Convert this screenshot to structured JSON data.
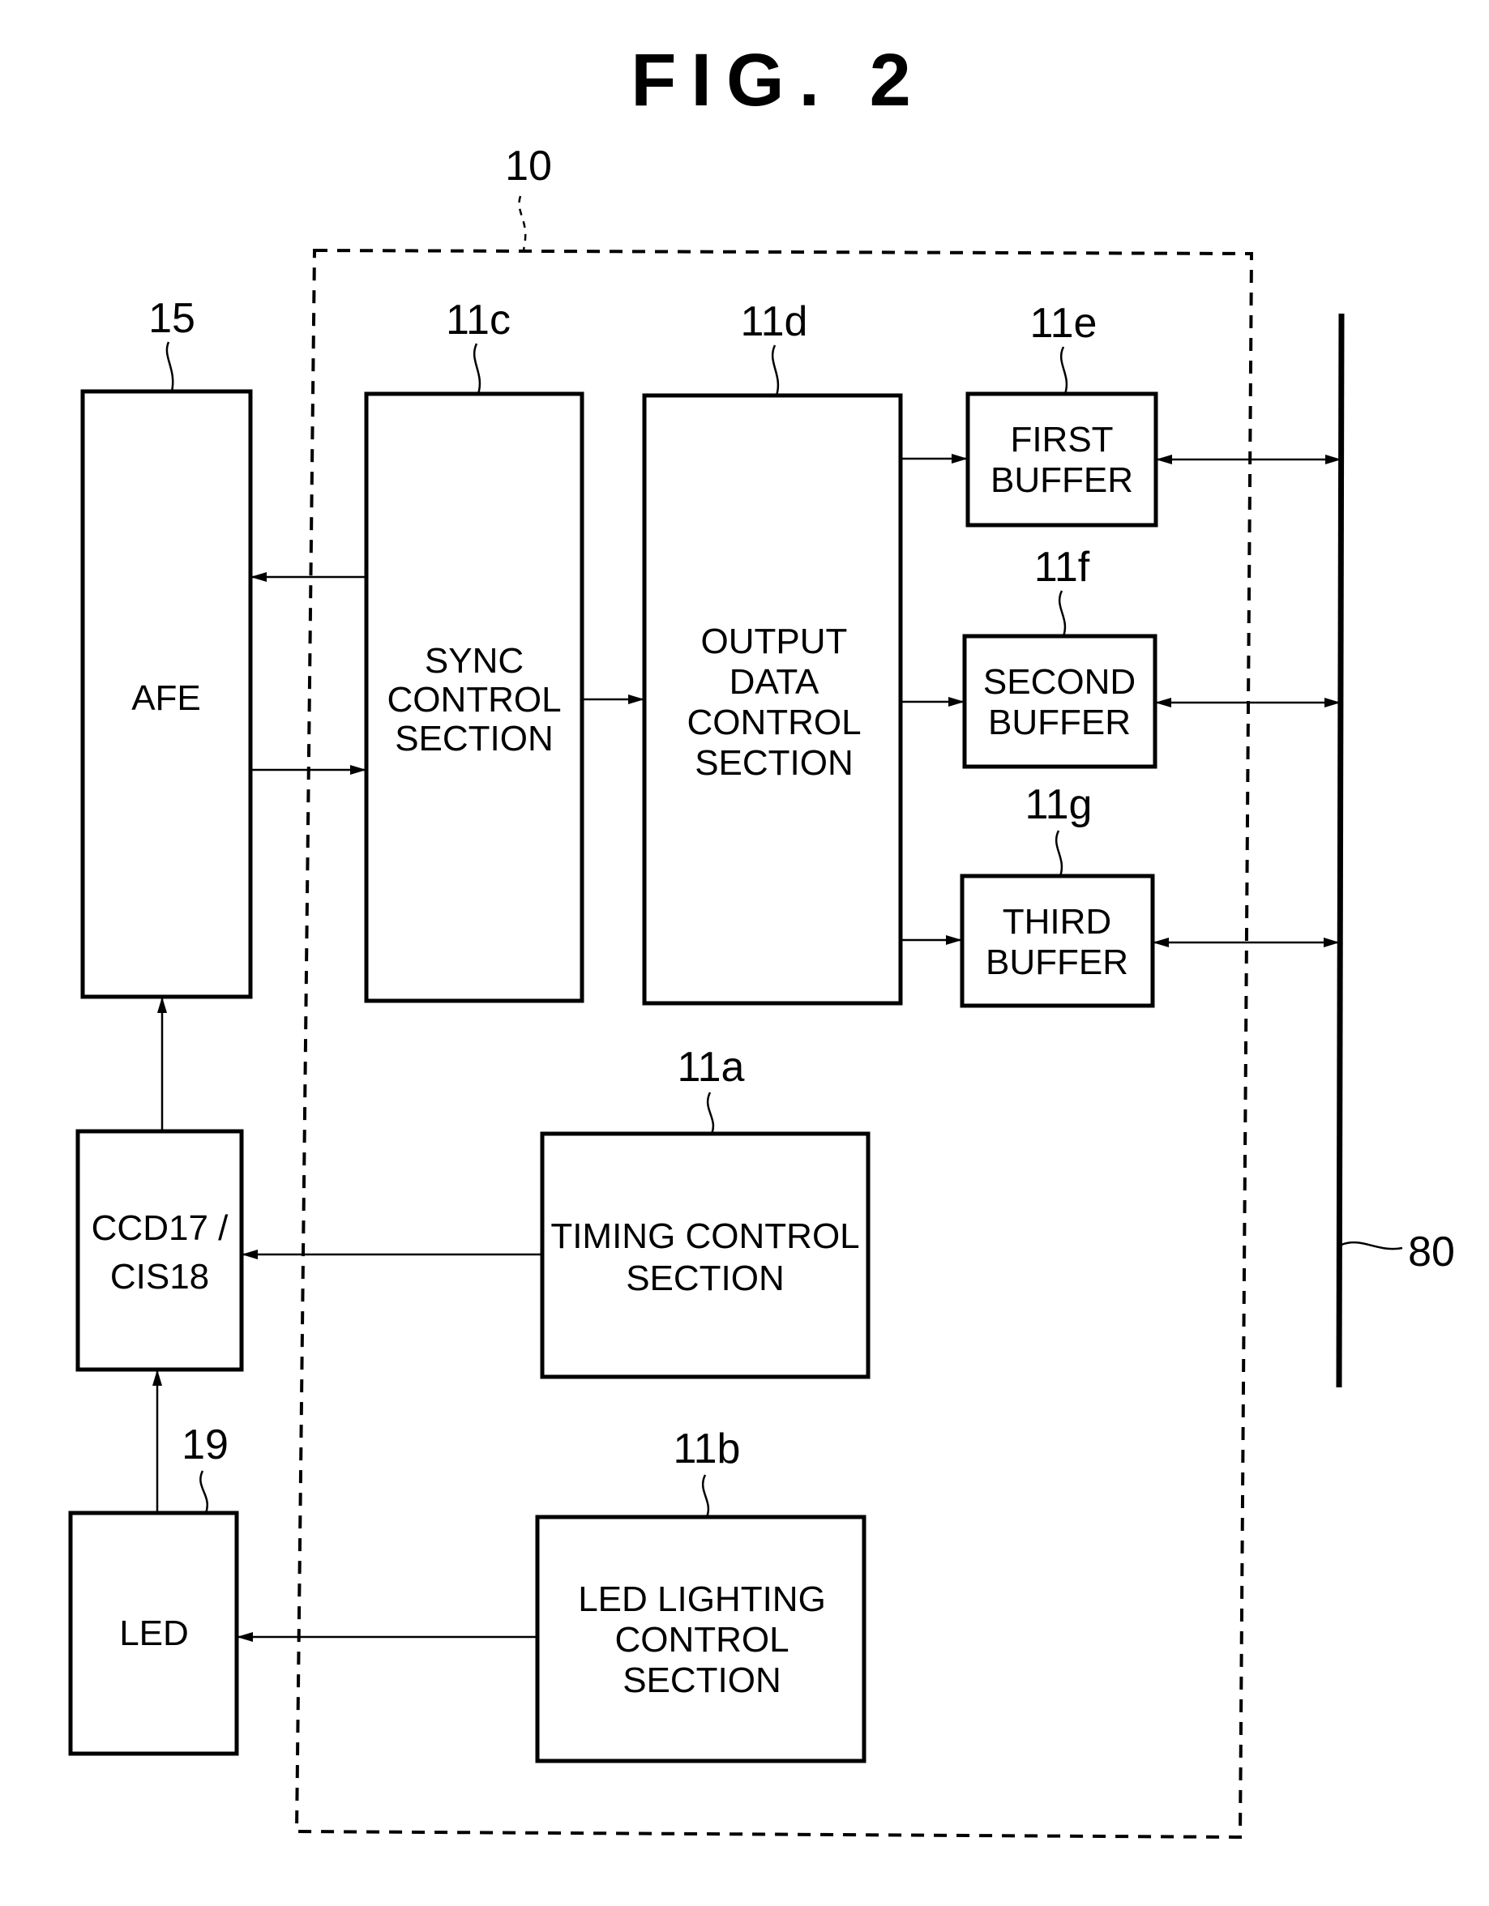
{
  "figure": {
    "title": "FIG. 2"
  },
  "container": {
    "ref": "10"
  },
  "bus": {
    "ref": "80"
  },
  "blocks": {
    "afe": {
      "ref": "15",
      "lines": [
        "AFE"
      ]
    },
    "sync": {
      "ref": "11c",
      "lines": [
        "SYNC",
        "CONTROL",
        "SECTION"
      ]
    },
    "output": {
      "ref": "11d",
      "lines": [
        "OUTPUT",
        "DATA",
        "CONTROL",
        "SECTION"
      ]
    },
    "first_buffer": {
      "ref": "11e",
      "lines": [
        "FIRST",
        "BUFFER"
      ]
    },
    "second_buffer": {
      "ref": "11f",
      "lines": [
        "SECOND",
        "BUFFER"
      ]
    },
    "third_buffer": {
      "ref": "11g",
      "lines": [
        "THIRD",
        "BUFFER"
      ]
    },
    "ccd": {
      "ref": "",
      "lines": [
        "CCD17 /",
        "CIS18"
      ]
    },
    "timing": {
      "ref": "11a",
      "lines": [
        "TIMING CONTROL",
        "SECTION"
      ]
    },
    "led": {
      "ref": "19",
      "lines": [
        "LED"
      ]
    },
    "led_lighting": {
      "ref": "11b",
      "lines": [
        "LED LIGHTING",
        "CONTROL",
        "SECTION"
      ]
    }
  },
  "connections": [
    {
      "from": "sync",
      "to": "afe",
      "direction": "one-way"
    },
    {
      "from": "afe",
      "to": "sync",
      "direction": "one-way"
    },
    {
      "from": "sync",
      "to": "output",
      "direction": "one-way"
    },
    {
      "from": "output",
      "to": "first_buffer",
      "direction": "one-way"
    },
    {
      "from": "output",
      "to": "second_buffer",
      "direction": "one-way"
    },
    {
      "from": "output",
      "to": "third_buffer",
      "direction": "one-way"
    },
    {
      "from": "first_buffer",
      "to": "bus",
      "direction": "two-way"
    },
    {
      "from": "second_buffer",
      "to": "bus",
      "direction": "two-way"
    },
    {
      "from": "third_buffer",
      "to": "bus",
      "direction": "two-way"
    },
    {
      "from": "ccd",
      "to": "afe",
      "direction": "one-way"
    },
    {
      "from": "timing",
      "to": "ccd",
      "direction": "one-way"
    },
    {
      "from": "led",
      "to": "ccd",
      "direction": "one-way"
    },
    {
      "from": "led_lighting",
      "to": "led",
      "direction": "one-way"
    }
  ]
}
